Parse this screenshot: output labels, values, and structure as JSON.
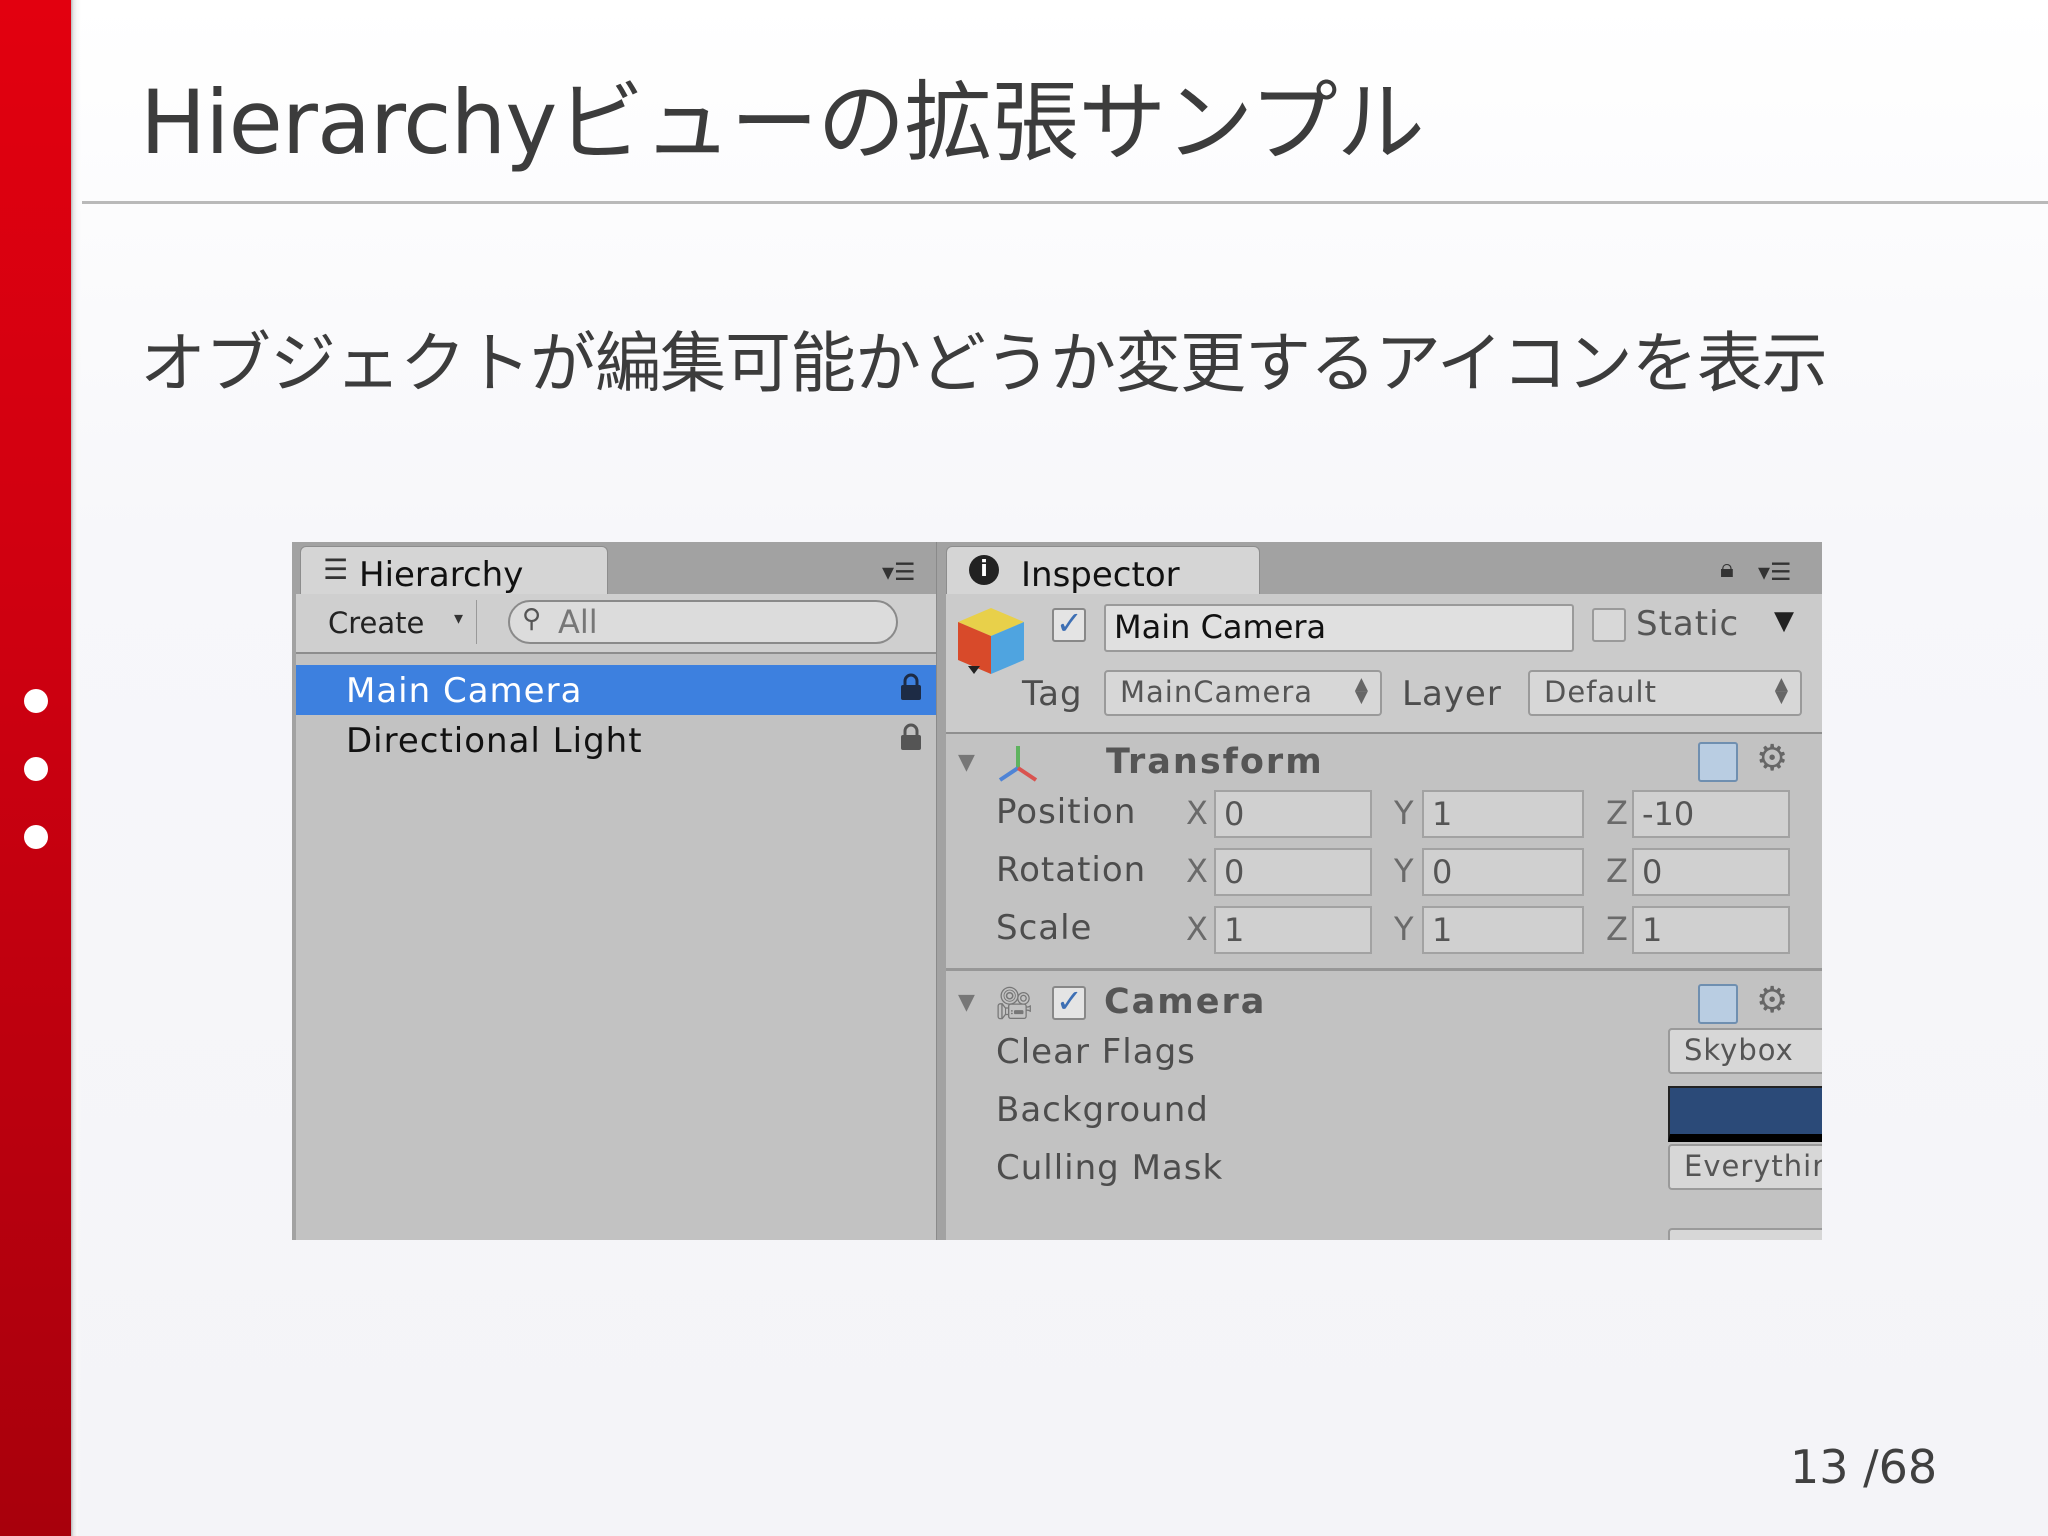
{
  "slide": {
    "title": "Hierarchyビューの拡張サンプル",
    "subtitle": "オブジェクトが編集可能かどうか変更するアイコンを表示",
    "page_number": "13 /68",
    "accent_color": "#d40010"
  },
  "hierarchy": {
    "tab_label": "Hierarchy",
    "tab_icon": "list-icon",
    "create_label": "Create",
    "search_placeholder": "All",
    "items": [
      {
        "label": "Main Camera",
        "selected": true,
        "icon": "lock-icon"
      },
      {
        "label": "Directional Light",
        "selected": false,
        "icon": "lock-icon"
      }
    ]
  },
  "inspector": {
    "tab_label": "Inspector",
    "object_name": "Main Camera",
    "static_label": "Static",
    "tag_label": "Tag",
    "tag_value": "MainCamera",
    "layer_label": "Layer",
    "layer_value": "Default",
    "transform": {
      "title": "Transform",
      "rows": [
        {
          "label": "Position",
          "x": "0",
          "y": "1",
          "z": "-10"
        },
        {
          "label": "Rotation",
          "x": "0",
          "y": "0",
          "z": "0"
        },
        {
          "label": "Scale",
          "x": "1",
          "y": "1",
          "z": "1"
        }
      ],
      "axis_labels": [
        "X",
        "Y",
        "Z"
      ]
    },
    "camera": {
      "title": "Camera",
      "clear_flags_label": "Clear Flags",
      "clear_flags_value": "Skybox",
      "background_label": "Background",
      "background_color": "#2b4a78",
      "culling_mask_label": "Culling Mask",
      "culling_mask_value": "Everything"
    }
  }
}
